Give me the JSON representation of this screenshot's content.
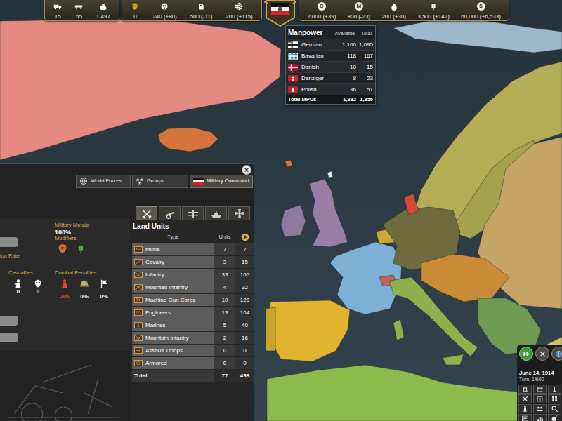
{
  "resources": {
    "left": [
      {
        "text": "15"
      },
      {
        "text": "55"
      },
      {
        "text": "1,497"
      }
    ],
    "middle": [
      {
        "text": "0"
      },
      {
        "text": "240 (+80)"
      },
      {
        "text": "500 (-11)"
      },
      {
        "text": "200 (+115)"
      }
    ],
    "right": [
      {
        "text": "2,000 (+39)",
        "glyph": "C"
      },
      {
        "text": "800 (-23)",
        "glyph": "M"
      },
      {
        "text": "200 (+30)"
      },
      {
        "text": "3,500 (+142)"
      },
      {
        "text": "60,000 (+6,533)",
        "glyph": "$"
      }
    ]
  },
  "manpower": {
    "title": "Manpower",
    "columns": [
      "Available",
      "Total"
    ],
    "rows": [
      {
        "name": "German",
        "available": "1,160",
        "total": "1,695"
      },
      {
        "name": "Bavarian",
        "available": "118",
        "total": "167"
      },
      {
        "name": "Danish",
        "available": "10",
        "total": "15"
      },
      {
        "name": "Danziger",
        "available": "8",
        "total": "23"
      },
      {
        "name": "Polish",
        "available": "36",
        "total": "51"
      }
    ],
    "footer": {
      "label": "Total MPUs",
      "available": "1,332",
      "total": "1,856"
    }
  },
  "panel": {
    "close": "×",
    "tabs": [
      {
        "label": "World Forces",
        "selected": false
      },
      {
        "label": "Groups",
        "selected": false
      },
      {
        "label": "Military Command",
        "selected": true
      }
    ],
    "unit_tabs": [
      {
        "selected": true
      },
      {
        "selected": false
      },
      {
        "selected": false
      },
      {
        "selected": false
      },
      {
        "selected": false
      }
    ],
    "stats": {
      "morale_label": "Military Morale",
      "morale_value": "100%",
      "modifiers_label": "Modifiers",
      "partial_label": "ion Rate",
      "casualties_label": "Casualties",
      "casualties": [
        "0",
        "0"
      ],
      "penalties_label": "Combat Penalties",
      "penalties": [
        {
          "value": "-6%",
          "negative": true
        },
        {
          "value": "0%",
          "negative": false
        },
        {
          "value": "0%",
          "negative": false
        }
      ]
    },
    "land_units": {
      "title": "Land Units",
      "columns": [
        "Type",
        "Units"
      ],
      "rows": [
        {
          "type": "Militia",
          "units": "7",
          "strength": "7"
        },
        {
          "type": "Cavalry",
          "units": "3",
          "strength": "15"
        },
        {
          "type": "Infantry",
          "units": "33",
          "strength": "165"
        },
        {
          "type": "Mounted Infantry",
          "units": "4",
          "strength": "32"
        },
        {
          "type": "Machine Gun Corps",
          "units": "10",
          "strength": "120"
        },
        {
          "type": "Engineers",
          "units": "13",
          "strength": "104"
        },
        {
          "type": "Marines",
          "units": "5",
          "strength": "40"
        },
        {
          "type": "Mountain Infantry",
          "units": "2",
          "strength": "16"
        },
        {
          "type": "Assault Troops",
          "units": "0",
          "strength": "0"
        },
        {
          "type": "Armored",
          "units": "0",
          "strength": "0"
        }
      ],
      "total": {
        "label": "Total",
        "units": "77",
        "strength": "499"
      }
    }
  },
  "turn_controls": {
    "date": "June 14, 1914",
    "turn": "Turn: 1/600"
  }
}
